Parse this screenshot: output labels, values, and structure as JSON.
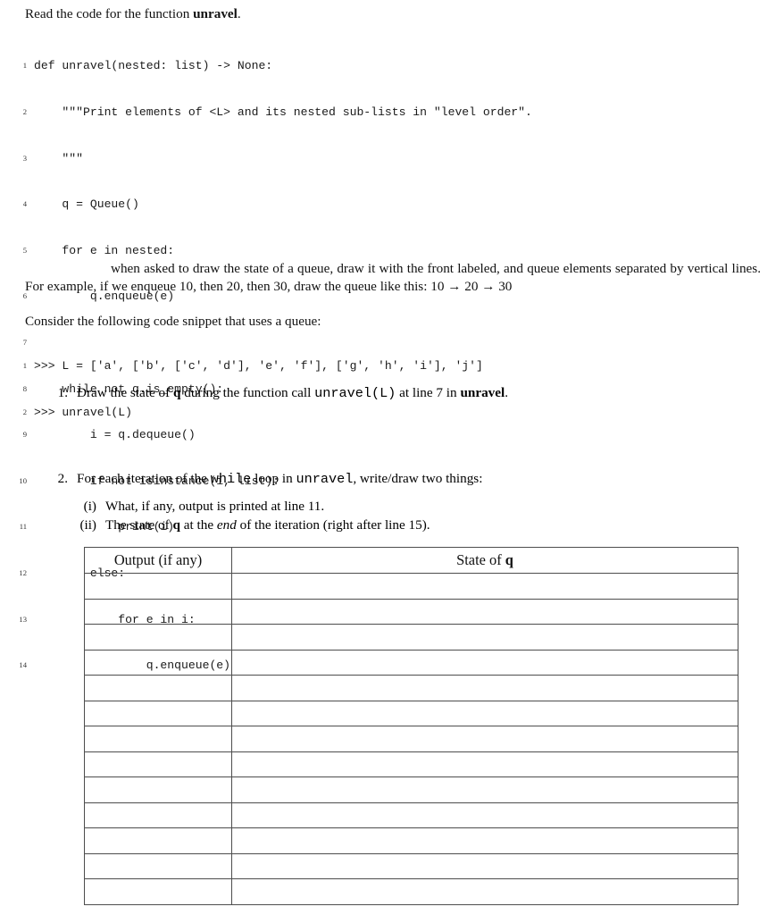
{
  "document": {
    "intro": {
      "prefix": "Read the code for the function ",
      "function_name": "unravel",
      "suffix": "."
    },
    "code_listings": [
      {
        "id": "unravel",
        "lines": [
          {
            "number": "1",
            "text": "def unravel(nested: list) -> None:"
          },
          {
            "number": "2",
            "text": "    \"\"\"Print elements of <L> and its nested sub-lists in \"level order\"."
          },
          {
            "number": "3",
            "text": "    \"\"\""
          },
          {
            "number": "4",
            "text": "    q = Queue()"
          },
          {
            "number": "5",
            "text": "    for e in nested:"
          },
          {
            "number": "6",
            "text": "        q.enqueue(e)"
          },
          {
            "number": "7",
            "text": ""
          },
          {
            "number": "8",
            "text": "    while not q.is_empty():"
          },
          {
            "number": "9",
            "text": "        i = q.dequeue()"
          },
          {
            "number": "10",
            "text": "        if not isinstance(i, list):"
          },
          {
            "number": "11",
            "text": "            print(i)"
          },
          {
            "number": "12",
            "text": "        else:"
          },
          {
            "number": "13",
            "text": "            for e in i:"
          },
          {
            "number": "14",
            "text": "                q.enqueue(e)"
          }
        ]
      },
      {
        "id": "snippet",
        "lines": [
          {
            "number": "1",
            "text": ">>> L = ['a', ['b', ['c', 'd'], 'e', 'f'], ['g', 'h', 'i'], 'j']"
          },
          {
            "number": "2",
            "text": ">>> unravel(L)"
          }
        ]
      }
    ],
    "queue_note": {
      "line1": "when asked to draw the state of a queue, draw it with the front labeled, and queue elements separated by",
      "line2_a": "vertical lines. For example, if we enqueue 10, then 20, then 30, draw the queue like this: ",
      "example_queue": "10 → 20 → 30"
    },
    "consider_line": "Consider the following code snippet that uses a queue:",
    "questions": [
      {
        "marker": "1.",
        "parts": {
          "t1": "Draw the state of ",
          "var1": "q",
          "t2": " during the function call ",
          "code1": "unravel(L)",
          "t3": " at line 7 in ",
          "bold1": "unravel",
          "t4": "."
        }
      },
      {
        "marker": "2.",
        "parts": {
          "t1": "For each iteration of the ",
          "code1": "while",
          "t2": " loop in ",
          "code2": "unravel",
          "t3": ", write/draw two things:"
        }
      }
    ],
    "subquestions": [
      {
        "marker": "(i)",
        "parts": {
          "t1": "What, if any, output is printed at line 11."
        }
      },
      {
        "marker": "(ii)",
        "parts": {
          "t1": "The state of ",
          "var1": "q",
          "t2": " at the ",
          "ital1": "end",
          "t3": " of the iteration (right after line 15)."
        }
      }
    ],
    "answer_table": {
      "headers": {
        "col1": "Output (if any)",
        "col2_prefix": "State of ",
        "col2_var": "q"
      },
      "row_count": 13,
      "rows": [
        {
          "output": "",
          "state": ""
        },
        {
          "output": "",
          "state": ""
        },
        {
          "output": "",
          "state": ""
        },
        {
          "output": "",
          "state": ""
        },
        {
          "output": "",
          "state": ""
        },
        {
          "output": "",
          "state": ""
        },
        {
          "output": "",
          "state": ""
        },
        {
          "output": "",
          "state": ""
        },
        {
          "output": "",
          "state": ""
        },
        {
          "output": "",
          "state": ""
        },
        {
          "output": "",
          "state": ""
        },
        {
          "output": "",
          "state": ""
        },
        {
          "output": "",
          "state": ""
        }
      ]
    },
    "colors": {
      "text": "#111111",
      "code_text": "#1a1a1a",
      "rule": "#4d4d4d",
      "background": "#ffffff"
    }
  }
}
